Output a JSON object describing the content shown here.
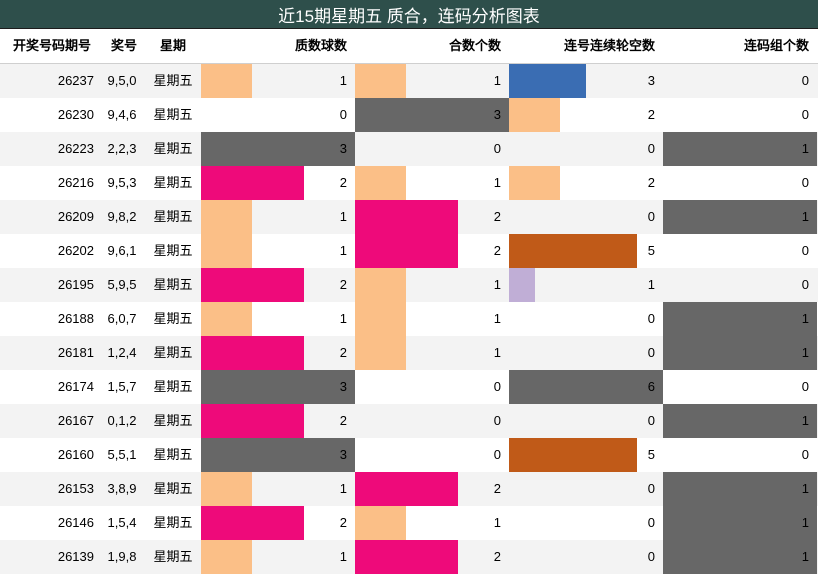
{
  "title": "近15期星期五 质合，连码分析图表",
  "columns": [
    "开奖号码期号",
    "奖号",
    "星期",
    "质数球数",
    "合数个数",
    "连号连续轮空数",
    "连码组个数"
  ],
  "colors": {
    "title_bg": "#2e4f4b",
    "level_1": "#fbbf87",
    "level_2": "#ee0a7a",
    "level_3": "#676767",
    "level_5": "#c05a18",
    "level_6": "#676767",
    "lavender_1": "#c0aed6",
    "blue_3": "#3a6db3",
    "row_alt": "#f3f3f3"
  },
  "chart_data": {
    "type": "table",
    "title": "近15期星期五 质合，连码分析图表",
    "columns": [
      "开奖号码期号",
      "奖号",
      "星期",
      "质数球数",
      "合数个数",
      "连号连续轮空数",
      "连码组个数"
    ],
    "rows": [
      {
        "issue": "26237",
        "numbers": "9,5,0",
        "weekday": "星期五",
        "prime_count": 1,
        "composite_count": 1,
        "consecutive_miss": 3,
        "consecutive_groups": 0
      },
      {
        "issue": "26230",
        "numbers": "9,4,6",
        "weekday": "星期五",
        "prime_count": 0,
        "composite_count": 3,
        "consecutive_miss": 2,
        "consecutive_groups": 0
      },
      {
        "issue": "26223",
        "numbers": "2,2,3",
        "weekday": "星期五",
        "prime_count": 3,
        "composite_count": 0,
        "consecutive_miss": 0,
        "consecutive_groups": 1
      },
      {
        "issue": "26216",
        "numbers": "9,5,3",
        "weekday": "星期五",
        "prime_count": 2,
        "composite_count": 1,
        "consecutive_miss": 2,
        "consecutive_groups": 0
      },
      {
        "issue": "26209",
        "numbers": "9,8,2",
        "weekday": "星期五",
        "prime_count": 1,
        "composite_count": 2,
        "consecutive_miss": 0,
        "consecutive_groups": 1
      },
      {
        "issue": "26202",
        "numbers": "9,6,1",
        "weekday": "星期五",
        "prime_count": 1,
        "composite_count": 2,
        "consecutive_miss": 5,
        "consecutive_groups": 0
      },
      {
        "issue": "26195",
        "numbers": "5,9,5",
        "weekday": "星期五",
        "prime_count": 2,
        "composite_count": 1,
        "consecutive_miss": 1,
        "consecutive_groups": 0
      },
      {
        "issue": "26188",
        "numbers": "6,0,7",
        "weekday": "星期五",
        "prime_count": 1,
        "composite_count": 1,
        "consecutive_miss": 0,
        "consecutive_groups": 1
      },
      {
        "issue": "26181",
        "numbers": "1,2,4",
        "weekday": "星期五",
        "prime_count": 2,
        "composite_count": 1,
        "consecutive_miss": 0,
        "consecutive_groups": 1
      },
      {
        "issue": "26174",
        "numbers": "1,5,7",
        "weekday": "星期五",
        "prime_count": 3,
        "composite_count": 0,
        "consecutive_miss": 6,
        "consecutive_groups": 0
      },
      {
        "issue": "26167",
        "numbers": "0,1,2",
        "weekday": "星期五",
        "prime_count": 2,
        "composite_count": 0,
        "consecutive_miss": 0,
        "consecutive_groups": 1
      },
      {
        "issue": "26160",
        "numbers": "5,5,1",
        "weekday": "星期五",
        "prime_count": 3,
        "composite_count": 0,
        "consecutive_miss": 5,
        "consecutive_groups": 0
      },
      {
        "issue": "26153",
        "numbers": "3,8,9",
        "weekday": "星期五",
        "prime_count": 1,
        "composite_count": 2,
        "consecutive_miss": 0,
        "consecutive_groups": 1
      },
      {
        "issue": "26146",
        "numbers": "1,5,4",
        "weekday": "星期五",
        "prime_count": 2,
        "composite_count": 1,
        "consecutive_miss": 0,
        "consecutive_groups": 1
      },
      {
        "issue": "26139",
        "numbers": "1,9,8",
        "weekday": "星期五",
        "prime_count": 1,
        "composite_count": 2,
        "consecutive_miss": 0,
        "consecutive_groups": 1
      }
    ],
    "bar_max": {
      "prime_count": 3,
      "composite_count": 3,
      "consecutive_miss": 6,
      "consecutive_groups": 1
    }
  }
}
